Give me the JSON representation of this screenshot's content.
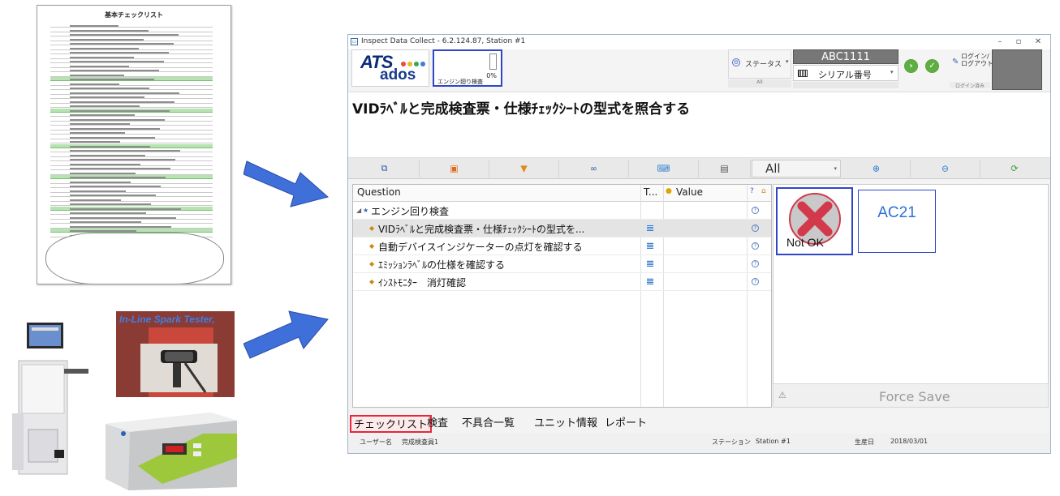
{
  "document": {
    "title": "基本チェックリスト"
  },
  "photos": {
    "spark_tester_label": "In-Line Spark Tester,"
  },
  "window": {
    "title": "Inspect Data Collect - 6.2.124.87, Station #1",
    "minimize": "–",
    "maximize": "▫",
    "close": "✕"
  },
  "header": {
    "logo_top": "ATS",
    "logo_bottom": "ados",
    "progress_label": "エンジン廻り検査",
    "progress_pct": "0%",
    "progress_value": 0,
    "status_label": "ステータス",
    "status_sub": "All",
    "serial_value": "ABC1111",
    "serial_label": "シリアル番号",
    "login_label": "ログイン/\nログアウト",
    "login_sub": "ログイン済み"
  },
  "instruction": "VIDﾗﾍﾞﾙと完成検査票・仕様ﾁｪｯｸｼｰﾄの型式を照合する",
  "toolbar": {
    "filter_value": "All",
    "icons": [
      "window-icon",
      "image-icon",
      "filter-icon",
      "binoculars-icon",
      "keyboard-icon",
      "note-icon"
    ]
  },
  "questions": {
    "header_question": "Question",
    "header_t": "T...",
    "header_value": "Value",
    "group": "エンジン回り検査",
    "items": [
      "VIDﾗﾍﾞﾙと完成検査票・仕様ﾁｪｯｸｼｰﾄの型式を...",
      "自動デバイスインジケーターの点灯を確認する",
      "ｴﾐｯｼｮﾝﾗﾍﾞﾙの仕様を確認する",
      "ｲﾝｽﾄﾓﾆﾀｰ　消灯確認"
    ]
  },
  "detail": {
    "result_label": "Not OK",
    "code_label": "AC21",
    "force_save": "Force Save"
  },
  "tabs": [
    "チェックリスト",
    "検査",
    "不具合一覧",
    "ユニット情報",
    "レポート"
  ],
  "statusbar": {
    "user_label": "ユーザー名",
    "user_value": "完成検査員1",
    "station_label": "ステーション",
    "station_value": "Station #1",
    "date_label": "生産日",
    "date_value": "2018/03/01"
  },
  "colors": {
    "accent_blue": "#2f46c8",
    "active_tab_border": "#e5263d",
    "arrow_blue": "#3f6fd8"
  }
}
